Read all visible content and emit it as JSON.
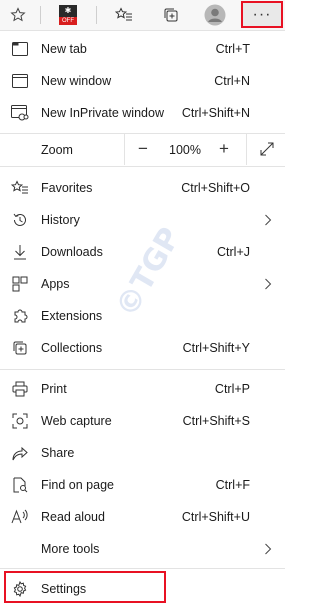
{
  "toolbar": {
    "more_label": "···",
    "badge_text": "OFF"
  },
  "menu": {
    "new_tab": {
      "label": "New tab",
      "shortcut": "Ctrl+T"
    },
    "new_window": {
      "label": "New window",
      "shortcut": "Ctrl+N"
    },
    "new_inprivate": {
      "label": "New InPrivate window",
      "shortcut": "Ctrl+Shift+N"
    },
    "zoom": {
      "label": "Zoom",
      "value": "100%",
      "minus": "−",
      "plus": "+"
    },
    "favorites": {
      "label": "Favorites",
      "shortcut": "Ctrl+Shift+O"
    },
    "history": {
      "label": "History"
    },
    "downloads": {
      "label": "Downloads",
      "shortcut": "Ctrl+J"
    },
    "apps": {
      "label": "Apps"
    },
    "extensions": {
      "label": "Extensions"
    },
    "collections": {
      "label": "Collections",
      "shortcut": "Ctrl+Shift+Y"
    },
    "print": {
      "label": "Print",
      "shortcut": "Ctrl+P"
    },
    "web_capture": {
      "label": "Web capture",
      "shortcut": "Ctrl+Shift+S"
    },
    "share": {
      "label": "Share"
    },
    "find": {
      "label": "Find on page",
      "shortcut": "Ctrl+F"
    },
    "read_aloud": {
      "label": "Read aloud",
      "shortcut": "Ctrl+Shift+U"
    },
    "more_tools": {
      "label": "More tools"
    },
    "settings": {
      "label": "Settings"
    }
  },
  "watermark": "©TGP",
  "colors": {
    "highlight": "#e81123"
  }
}
